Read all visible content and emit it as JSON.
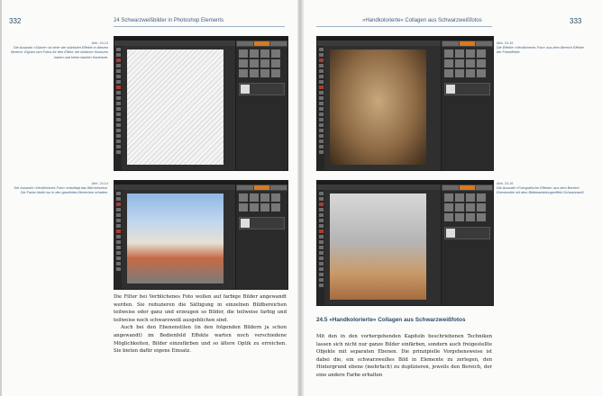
{
  "left_page": {
    "page_number": "332",
    "running_head": "24  Schwarzweißbilder in Photoshop Elements",
    "figure_1": {
      "label": "Abb. 24.13",
      "caption": "Die Auswahl »Skizze« ist einer der stärksten Effekte in diesem Bereich. Eignen sich Fotos für den Effekt, die einfache Konturen haben und keine starken Kontraste."
    },
    "figure_2": {
      "label": "Abb. 24.14",
      "caption": "Die Auswahl »Verblichenes Foto« entsättigt das Bild teilweise. Die Farbe bleibt nur in den gewählten Bereichen erhalten."
    },
    "body_paragraphs": [
      "Die Filter bei Verblichenes Foto wollen auf farbige Bilder angewandt werden. Sie reduzieren die Sättigung in einzelnen Bildbereichen teilweise oder ganz und erzeugen so Bilder, die teilweise farbig und teilweise noch schwarzweiß ausgeblichen sind.",
      "Auch bei den Ebenenstilen (in den folgenden Bildern ja schon angewandt) im Bedienfeld Effekte warten noch verschiedene Möglichkeiten, Bilder einzufärben und so ältere Optik zu erreichen. Sie bieten dafür eigene Einsatz."
    ]
  },
  "right_page": {
    "page_number": "333",
    "running_head": "»Handkolorierte« Collagen aus Schwarzweißfotos",
    "figure_1": {
      "label": "Abb. 24.15",
      "caption": "Die Effekte »Verblichenes Foto« aus dem Bereich Effekte der Fotoeffekte."
    },
    "figure_2": {
      "label": "Abb. 24.16",
      "caption": "Die Auswahl »Fotografische Effekte« aus dem Bereich Ebenenstile mit dem Bildbearbeitungseffekt Schwarzweiß."
    },
    "section_heading": "24.5  »Handkolorierte« Collagen aus Schwarzweißfotos",
    "body_paragraph": "Mit den in den vorhergehenden Kapiteln beschriebenen Techniken lassen sich nicht nur ganze Bilder einfärben, sondern auch freigestellte Objekte mit separaten Ebenen. Die prinzipielle Vorgehensweise ist dabei die, ein schwarzweißes Bild in Elemente zu zerlegen, den Hintergrund ebene (mehrfach) zu duplizieren, jeweils den Bereich, der eine andere Farbe erhalten"
  },
  "colors": {
    "caption_blue": "#3d5c82",
    "heading_blue": "#2d4b6a",
    "ui_dark": "#2f2f2f",
    "ui_accent_orange": "#d77a20"
  }
}
